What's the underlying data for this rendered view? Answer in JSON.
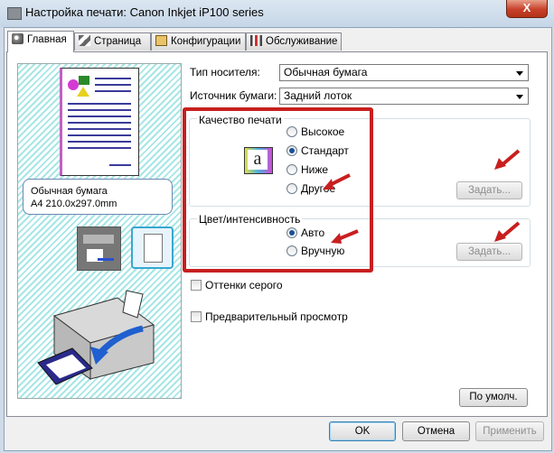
{
  "window": {
    "title": "Настройка печати: Canon Inkjet iP100 series",
    "close_label": "X"
  },
  "tabs": [
    {
      "label": "Главная",
      "icon": "main-tab-icon"
    },
    {
      "label": "Страница",
      "icon": "page-setup-icon"
    },
    {
      "label": "Конфигурации",
      "icon": "profiles-icon"
    },
    {
      "label": "Обслуживание",
      "icon": "maintenance-icon"
    }
  ],
  "preview": {
    "paper_line1": "Обычная бумага",
    "paper_line2": "A4 210.0x297.0mm"
  },
  "media": {
    "label": "Тип носителя:",
    "value": "Обычная бумага"
  },
  "source": {
    "label": "Источник бумаги:",
    "value": "Задний лоток"
  },
  "quality": {
    "title": "Качество печати",
    "options": [
      "Высокое",
      "Стандарт",
      "Ниже",
      "Другое"
    ],
    "selected": "Стандарт",
    "set_button": "Задать..."
  },
  "color": {
    "title": "Цвет/интенсивность",
    "options": [
      "Авто",
      "Вручную"
    ],
    "selected": "Авто",
    "set_button": "Задать..."
  },
  "grayscale": {
    "label": "Оттенки серого",
    "checked": false
  },
  "preview_before": {
    "label": "Предварительный просмотр",
    "checked": false
  },
  "defaults_button": "По умолч.",
  "footer": {
    "ok": "OK",
    "cancel": "Отмена",
    "apply": "Применить"
  },
  "colors": {
    "highlight": "#c81f1f",
    "selection": "#1b4f9a"
  }
}
